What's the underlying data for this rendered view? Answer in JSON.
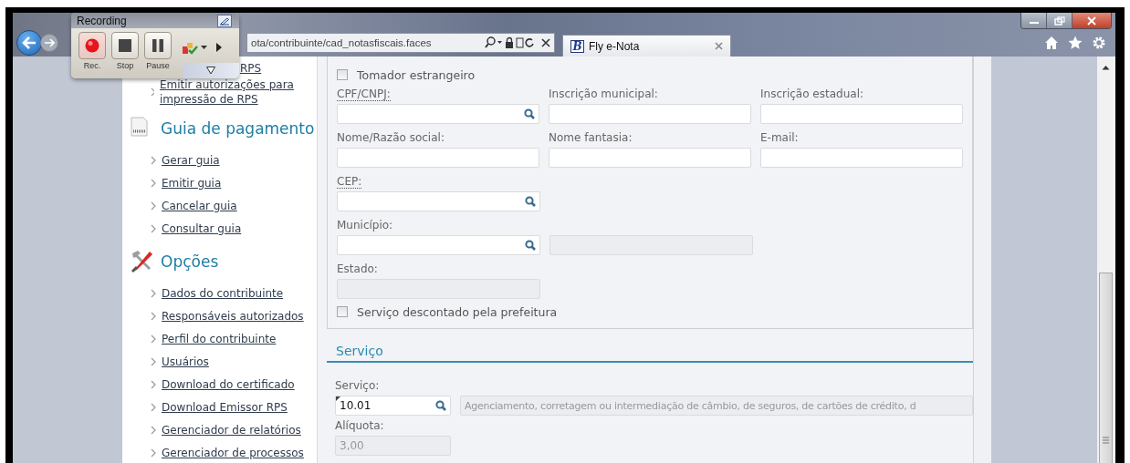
{
  "recorder": {
    "title": "Recording",
    "buttons": [
      {
        "kind": "record",
        "label": "Rec."
      },
      {
        "kind": "stop",
        "label": "Stop"
      },
      {
        "kind": "pause",
        "label": "Pause"
      }
    ]
  },
  "browser": {
    "address": "ota/contribuinte/cad_notasfiscais.faces",
    "tabs": [
      {
        "title": "Fly e-Nota",
        "icon_letter": "B",
        "selected": true
      }
    ]
  },
  "sidebar": {
    "groups": [
      {
        "items": [
          "RPS",
          "Emitir autorizações para impressão de RPS"
        ]
      },
      {
        "title": "Guia de pagamento",
        "kind": "document",
        "items": [
          "Gerar guia",
          "Emitir guia",
          "Cancelar guia",
          "Consultar guia"
        ]
      },
      {
        "title": "Opções",
        "kind": "tools",
        "items": [
          "Dados do contribuinte",
          "Responsáveis autorizados",
          "Perfil do contribuinte",
          "Usuários",
          "Download do certificado",
          "Download Emissor RPS",
          "Gerenciador de relatórios",
          "Gerenciador de processos"
        ]
      }
    ]
  },
  "taker": {
    "foreign": {
      "label": "Tomador estrangeiro",
      "checked": false
    },
    "rows": [
      [
        {
          "label": "CPF/CNPJ:",
          "abbr": true,
          "lookup": true,
          "disabled": false
        },
        {
          "label": "Inscrição municipal:",
          "lookup": false,
          "disabled": false
        },
        {
          "label": "Inscrição estadual:",
          "lookup": false,
          "disabled": false
        }
      ],
      [
        {
          "label": "Nome/Razão social:",
          "lookup": false,
          "disabled": false
        },
        {
          "label": "Nome fantasia:",
          "lookup": false,
          "disabled": false
        },
        {
          "label": "E-mail:",
          "lookup": false,
          "disabled": false
        }
      ],
      [
        {
          "label": "CEP:",
          "abbr": true,
          "lookup": true,
          "disabled": false
        }
      ],
      [
        {
          "label": "Município:",
          "lookup": true,
          "disabled": false
        },
        {
          "lookup": false,
          "disabled": true
        }
      ],
      [
        {
          "label": "Estado:",
          "lookup": false,
          "disabled": true
        }
      ]
    ],
    "discount": {
      "label": "Serviço descontado pela prefeitura",
      "checked": false
    }
  },
  "service": {
    "title": "Serviço",
    "code": {
      "label": "Serviço:",
      "value": "10.01",
      "lookup": true,
      "disabled": false
    },
    "description": {
      "value": "Agenciamento, corretagem ou intermediação de câmbio, de seguros, de cartões de crédito, d",
      "lookup": false,
      "disabled": true
    },
    "rate": {
      "label": "Alíquota:",
      "value": "3,00",
      "lookup": false,
      "disabled": true
    }
  }
}
